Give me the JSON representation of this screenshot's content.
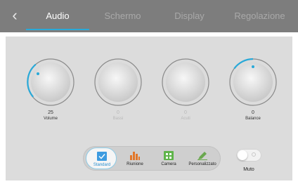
{
  "header": {
    "back_icon": "chevron-left-icon",
    "tabs": [
      {
        "label": "Audio",
        "active": true
      },
      {
        "label": "Schermo",
        "active": false
      },
      {
        "label": "Display",
        "active": false
      },
      {
        "label": "Regolazione",
        "active": false
      }
    ]
  },
  "knobs": [
    {
      "label": "Volume",
      "value": "25",
      "enabled": true
    },
    {
      "label": "Bassi",
      "value": "0",
      "enabled": false
    },
    {
      "label": "Acuti",
      "value": "0",
      "enabled": false
    },
    {
      "label": "Balance",
      "value": "0",
      "enabled": true
    }
  ],
  "presets": [
    {
      "label": "Standard",
      "icon": "check-icon",
      "color": "#3d9be0",
      "active": true
    },
    {
      "label": "Riunione",
      "icon": "bar-chart-icon",
      "color": "#e2772a",
      "active": false
    },
    {
      "label": "Camera",
      "icon": "grid-icon",
      "color": "#5fb44a",
      "active": false
    },
    {
      "label": "Personalizzato",
      "icon": "pencil-icon",
      "color": "#6aa84f",
      "active": false
    }
  ],
  "mute": {
    "label": "Muto",
    "on": false
  },
  "colors": {
    "accent": "#29a9d8",
    "header_bg": "#7d7d7d",
    "panel_bg": "#dcdcdc"
  }
}
